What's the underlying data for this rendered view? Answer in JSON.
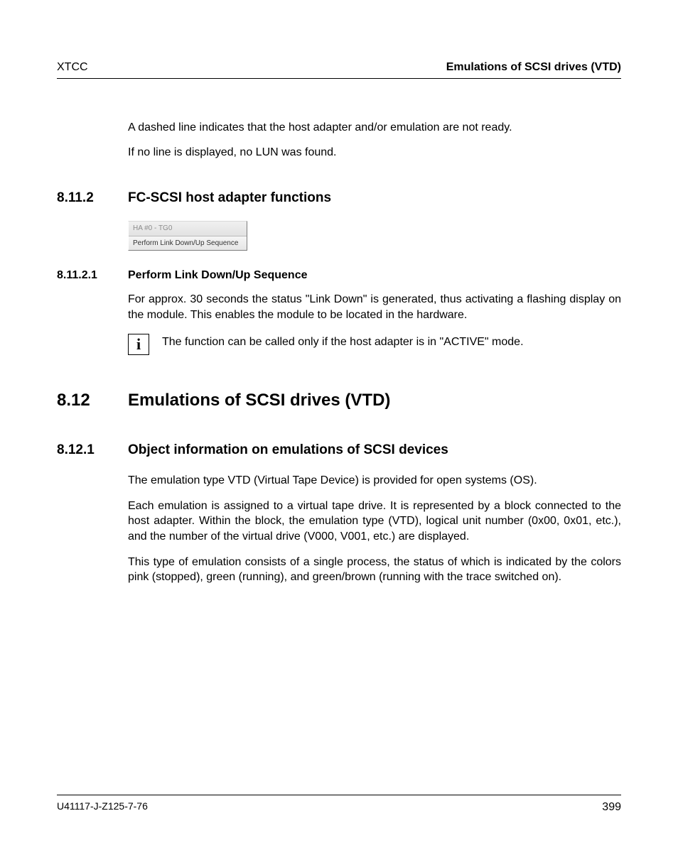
{
  "header": {
    "left": "XTCC",
    "right": "Emulations of SCSI drives (VTD)"
  },
  "intro": {
    "p1": "A dashed line indicates that the host adapter and/or emulation are not ready.",
    "p2": "If no line is displayed, no LUN was found."
  },
  "sec_8_11_2": {
    "num": "8.11.2",
    "title": "FC-SCSI host adapter functions",
    "menu": {
      "header": "HA #0 - TG0",
      "item": "Perform Link Down/Up Sequence"
    }
  },
  "sec_8_11_2_1": {
    "num": "8.11.2.1",
    "title": "Perform Link Down/Up Sequence",
    "p1": "For approx. 30 seconds the status \"Link Down\" is generated, thus activating a flashing display on the module. This enables the module to be located in the hardware.",
    "info_icon": "i",
    "info_text": "The function can be called only if the host adapter is in \"ACTIVE\" mode."
  },
  "sec_8_12": {
    "num": "8.12",
    "title": "Emulations of SCSI drives (VTD)"
  },
  "sec_8_12_1": {
    "num": "8.12.1",
    "title": "Object information on emulations of SCSI devices",
    "p1": "The emulation type VTD (Virtual Tape Device) is provided for open systems (OS).",
    "p2": "Each emulation is assigned to a virtual tape drive. It is represented by a block connected to the host adapter. Within the block, the emulation type (VTD), logical unit number (0x00, 0x01, etc.), and the number of the virtual drive (V000, V001, etc.) are displayed.",
    "p3": "This type of emulation consists of a single process, the status of which is indicated by the colors pink (stopped), green (running), and green/brown (running with the trace switched on)."
  },
  "footer": {
    "left": "U41117-J-Z125-7-76",
    "right": "399"
  }
}
